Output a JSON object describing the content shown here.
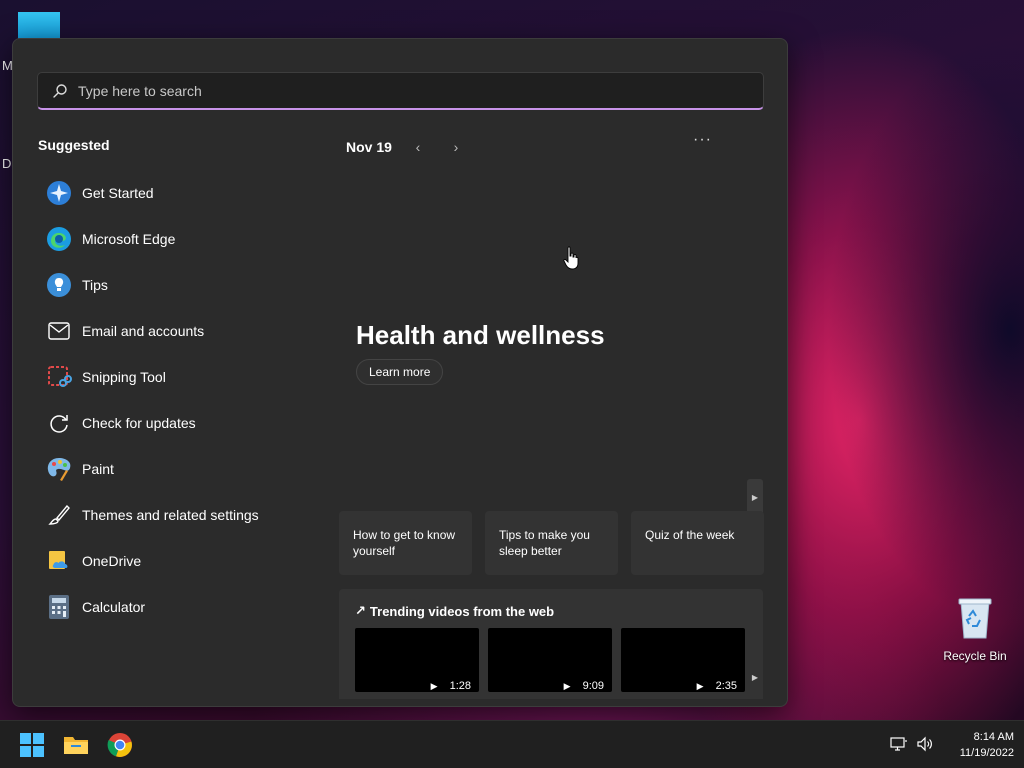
{
  "desktop": {
    "fragments": [
      "M",
      "Da"
    ],
    "recycle_bin_label": "Recycle Bin"
  },
  "start_menu": {
    "search": {
      "placeholder": "Type here to search",
      "value": ""
    },
    "suggested_title": "Suggested",
    "suggested": [
      {
        "label": "Get Started",
        "icon": "get-started-icon"
      },
      {
        "label": "Microsoft Edge",
        "icon": "edge-icon"
      },
      {
        "label": "Tips",
        "icon": "tips-icon"
      },
      {
        "label": "Email and accounts",
        "icon": "mail-icon"
      },
      {
        "label": "Snipping Tool",
        "icon": "snipping-tool-icon"
      },
      {
        "label": "Check for updates",
        "icon": "refresh-icon"
      },
      {
        "label": "Paint",
        "icon": "paint-icon"
      },
      {
        "label": "Themes and related settings",
        "icon": "brush-icon"
      },
      {
        "label": "OneDrive",
        "icon": "onedrive-icon"
      },
      {
        "label": "Calculator",
        "icon": "calculator-icon"
      }
    ],
    "feed": {
      "date": "Nov 19",
      "hero_title": "Health and wellness",
      "learn_more": "Learn more",
      "cards": [
        "How to get to know yourself",
        "Tips to make you sleep better",
        "Quiz of the week"
      ],
      "trending_title": "Trending videos from the web",
      "videos": [
        {
          "duration": "1:28"
        },
        {
          "duration": "9:09"
        },
        {
          "duration": "2:35"
        }
      ]
    }
  },
  "taskbar": {
    "apps": [
      "windows-start-icon",
      "file-explorer-icon",
      "chrome-icon"
    ],
    "time": "8:14 AM",
    "date": "11/19/2022"
  },
  "colors": {
    "search_accent": "#c893e8",
    "panel_bg": "#2b2b2b",
    "taskbar_bg": "#202020"
  }
}
